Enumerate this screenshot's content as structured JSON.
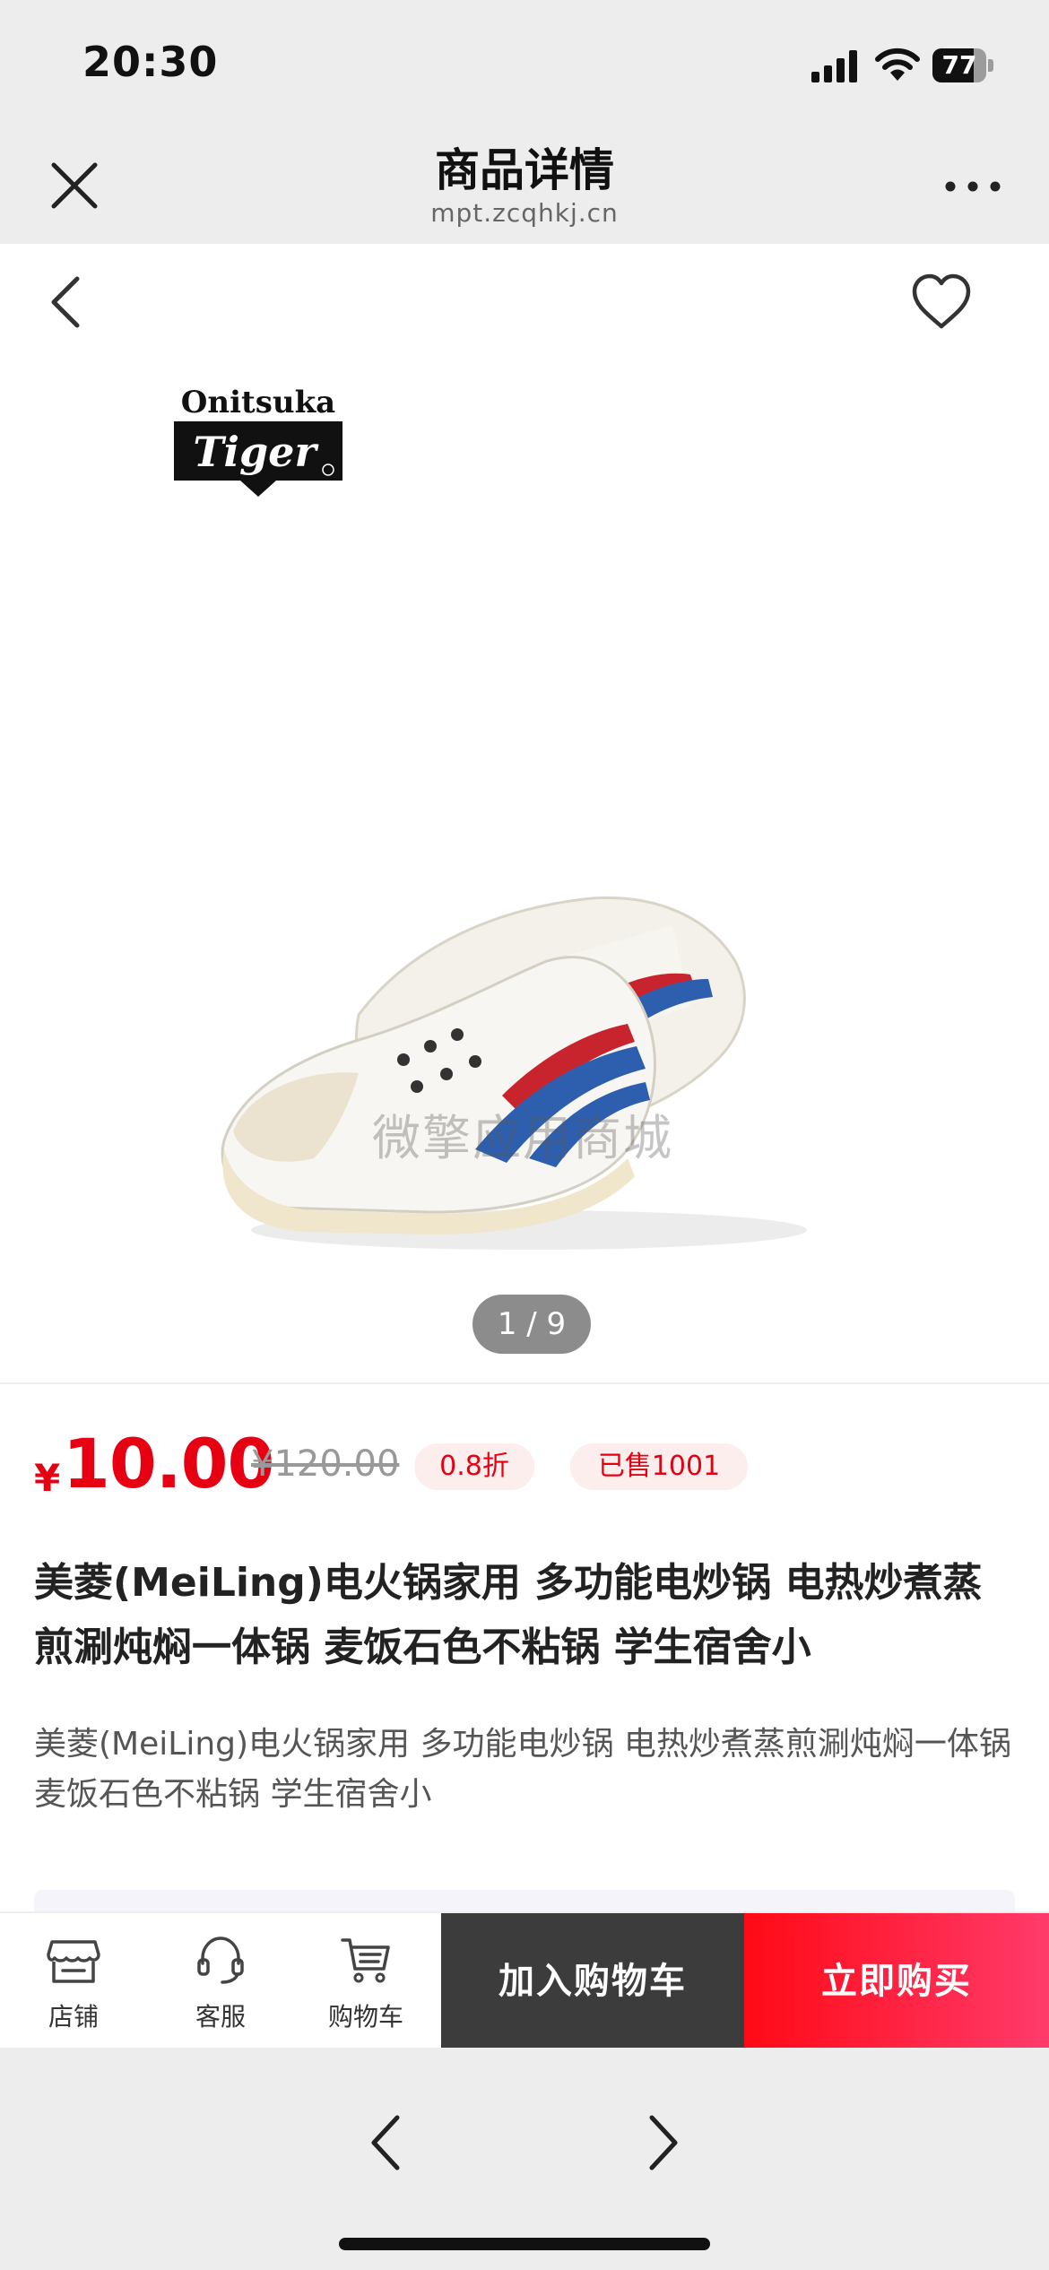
{
  "status_bar": {
    "time": "20:30",
    "battery": "77",
    "battery_level": 0.77
  },
  "webview": {
    "title": "商品详情",
    "domain": "mpt.zcqhkj.cn"
  },
  "gallery": {
    "brand_line1": "Onitsuka",
    "brand_line2": "Tiger",
    "watermark": "微擎应用商城",
    "pager": "1 / 9"
  },
  "product": {
    "currency": "¥",
    "price": "10.00",
    "original_price": "¥120.00",
    "discount": "0.8折",
    "sold": "已售1001",
    "title": "美菱(MeiLing)电火锅家用 多功能电炒锅 电热炒煮蒸煎涮炖焖一体锅 麦饭石色不粘锅 学生宿舍小",
    "description": "美菱(MeiLing)电火锅家用 多功能电炒锅 电热炒煮蒸煎涮炖焖一体锅 麦饭石色不粘锅 学生宿舍小"
  },
  "action_bar": {
    "shop_label": "店铺",
    "service_label": "客服",
    "cart_label": "购物车",
    "add_to_cart": "加入购物车",
    "buy_now": "立即购买"
  },
  "icons": {
    "close": "close-icon",
    "more": "more-icon",
    "back": "back-icon",
    "favorite": "heart-icon",
    "shop": "store-icon",
    "service": "headset-icon",
    "cart": "cart-icon"
  },
  "colors": {
    "accent": "#e60012",
    "buy_button": "#ff0a16",
    "cart_button": "#3c3c3c"
  }
}
